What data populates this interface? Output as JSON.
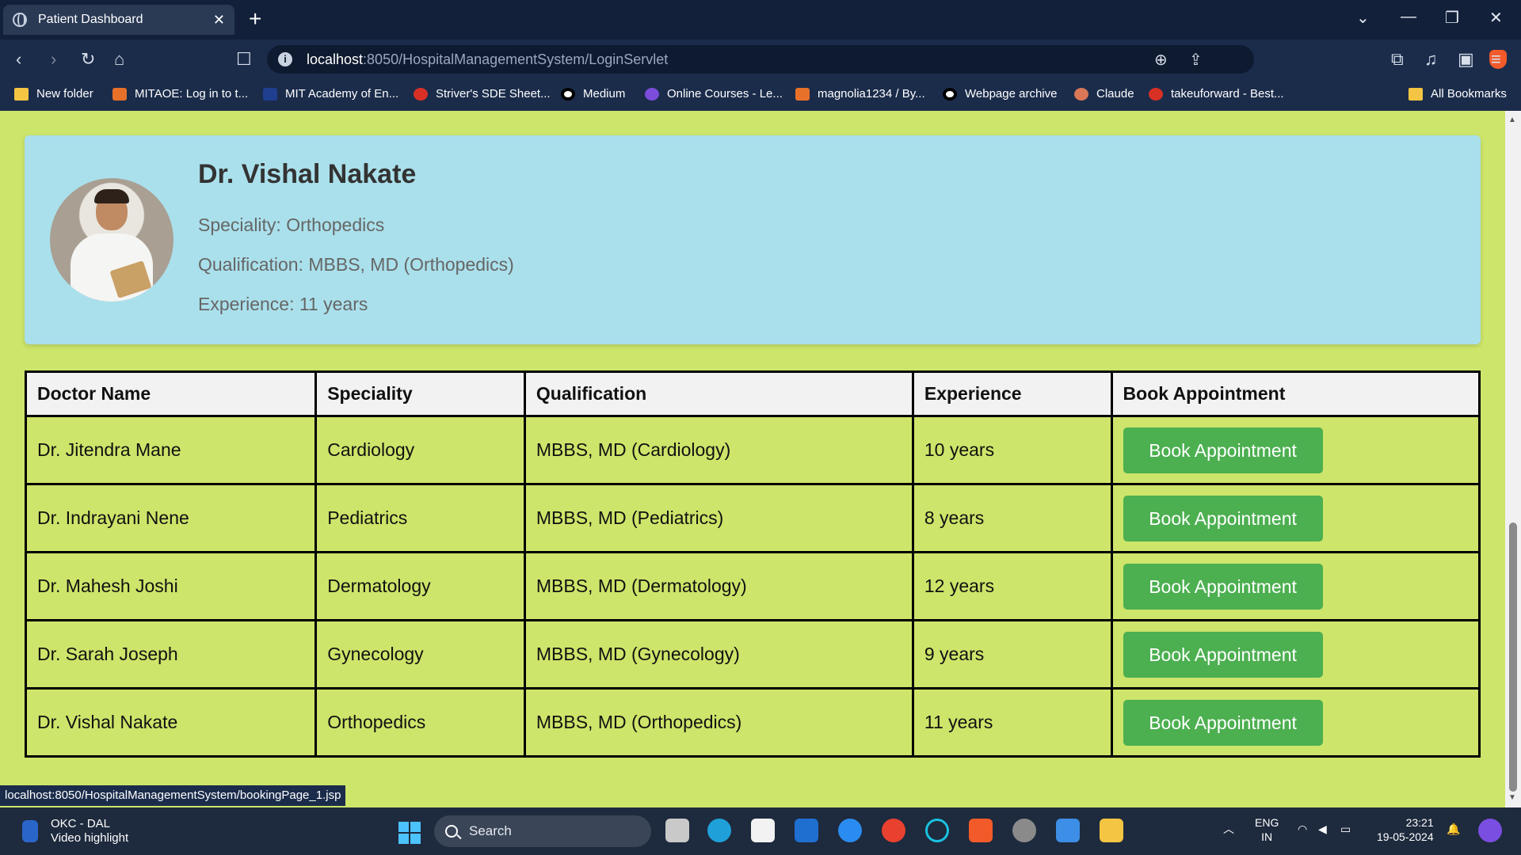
{
  "browser": {
    "tab_title": "Patient Dashboard",
    "tab_close": "✕",
    "new_tab": "+",
    "url_host": "localhost",
    "url_rest": ":8050/HospitalManagementSystem/LoginServlet",
    "bookmarks": [
      {
        "label": "New folder",
        "icon": "folder-icon"
      },
      {
        "label": "MITAOE: Log in to t...",
        "icon": "mitaoe-icon"
      },
      {
        "label": "MIT Academy of En...",
        "icon": "mit-icon"
      },
      {
        "label": "Striver's SDE Sheet...",
        "icon": "tuf-icon"
      },
      {
        "label": "Medium",
        "icon": "medium-icon"
      },
      {
        "label": "Online Courses - Le...",
        "icon": "courses-icon"
      },
      {
        "label": "magnolia1234 / By...",
        "icon": "gitlab-icon"
      },
      {
        "label": "Webpage archive",
        "icon": "archive-icon"
      },
      {
        "label": "Claude",
        "icon": "claude-icon"
      },
      {
        "label": "takeuforward - Best...",
        "icon": "tuf-icon"
      }
    ],
    "all_bookmarks": "All Bookmarks",
    "status_url": "localhost:8050/HospitalManagementSystem/bookingPage_1.jsp"
  },
  "profile": {
    "name": "Dr. Vishal Nakate",
    "speciality": "Speciality: Orthopedics",
    "qualification": "Qualification: MBBS, MD (Orthopedics)",
    "experience": "Experience: 11 years"
  },
  "table": {
    "headers": [
      "Doctor Name",
      "Speciality",
      "Qualification",
      "Experience",
      "Book Appointment"
    ],
    "rows": [
      {
        "name": "Dr. Jitendra Mane",
        "speciality": "Cardiology",
        "qualification": "MBBS, MD (Cardiology)",
        "experience": "10 years",
        "button": "Book Appointment"
      },
      {
        "name": "Dr. Indrayani Nene",
        "speciality": "Pediatrics",
        "qualification": "MBBS, MD (Pediatrics)",
        "experience": "8 years",
        "button": "Book Appointment"
      },
      {
        "name": "Dr. Mahesh Joshi",
        "speciality": "Dermatology",
        "qualification": "MBBS, MD (Dermatology)",
        "experience": "12 years",
        "button": "Book Appointment"
      },
      {
        "name": "Dr. Sarah Joseph",
        "speciality": "Gynecology",
        "qualification": "MBBS, MD (Gynecology)",
        "experience": "9 years",
        "button": "Book Appointment"
      },
      {
        "name": "Dr. Vishal Nakate",
        "speciality": "Orthopedics",
        "qualification": "MBBS, MD (Orthopedics)",
        "experience": "11 years",
        "button": "Book Appointment"
      }
    ]
  },
  "taskbar": {
    "weather_title": "OKC - DAL",
    "weather_sub": "Video highlight",
    "search_label": "Search",
    "lang_top": "ENG",
    "lang_bottom": "IN",
    "time": "23:21",
    "date": "19-05-2024"
  },
  "colors": {
    "page_bg": "#cde56a",
    "profile_bg": "#aae0eb",
    "button_bg": "#4caf50",
    "header_bg": "#f2f2f2"
  }
}
